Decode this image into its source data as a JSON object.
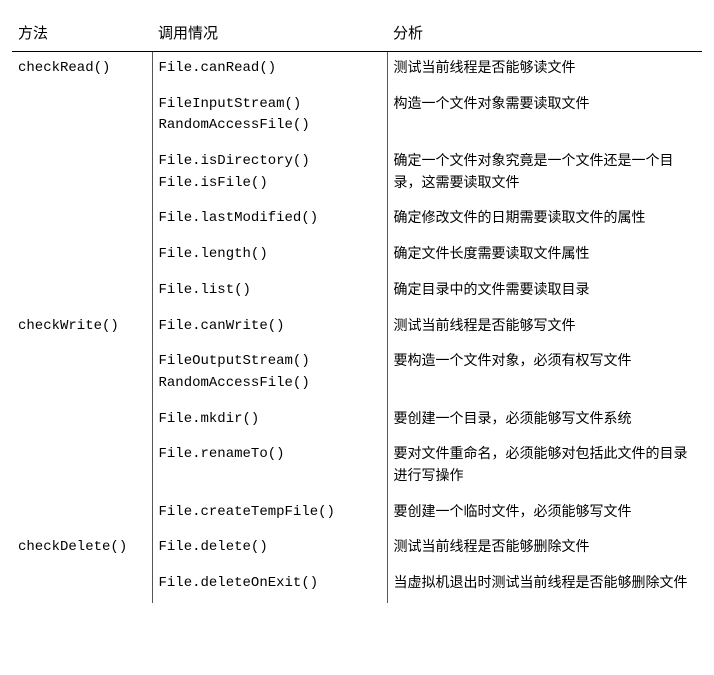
{
  "headers": {
    "method": "方法",
    "call": "调用情况",
    "analysis": "分析"
  },
  "rows": [
    {
      "method": "checkRead()",
      "call": "File.canRead()",
      "analysis": "测试当前线程是否能够读文件"
    },
    {
      "method": "",
      "call": "FileInputStream()\nRandomAccessFile()",
      "analysis": "构造一个文件对象需要读取文件"
    },
    {
      "method": "",
      "call": "File.isDirectory()\nFile.isFile()",
      "analysis": "确定一个文件对象究竟是一个文件还是一个目录，这需要读取文件"
    },
    {
      "method": "",
      "call": "File.lastModified()",
      "analysis": "确定修改文件的日期需要读取文件的属性"
    },
    {
      "method": "",
      "call": "File.length()",
      "analysis": "确定文件长度需要读取文件属性"
    },
    {
      "method": "",
      "call": "File.list()",
      "analysis": "确定目录中的文件需要读取目录"
    },
    {
      "method": "checkWrite()",
      "call": "File.canWrite()",
      "analysis": "测试当前线程是否能够写文件"
    },
    {
      "method": "",
      "call": "FileOutputStream()\nRandomAccessFile()",
      "analysis": "要构造一个文件对象，必须有权写文件"
    },
    {
      "method": "",
      "call": "File.mkdir()",
      "analysis": "要创建一个目录，必须能够写文件系统"
    },
    {
      "method": "",
      "call": "File.renameTo()",
      "analysis": "要对文件重命名，必须能够对包括此文件的目录进行写操作"
    },
    {
      "method": "",
      "call": "File.createTempFile()",
      "analysis": "要创建一个临时文件，必须能够写文件"
    },
    {
      "method": "checkDelete()",
      "call": "File.delete()",
      "analysis": "测试当前线程是否能够删除文件"
    },
    {
      "method": "",
      "call": "File.deleteOnExit()",
      "analysis": "当虚拟机退出时测试当前线程是否能够删除文件"
    }
  ]
}
